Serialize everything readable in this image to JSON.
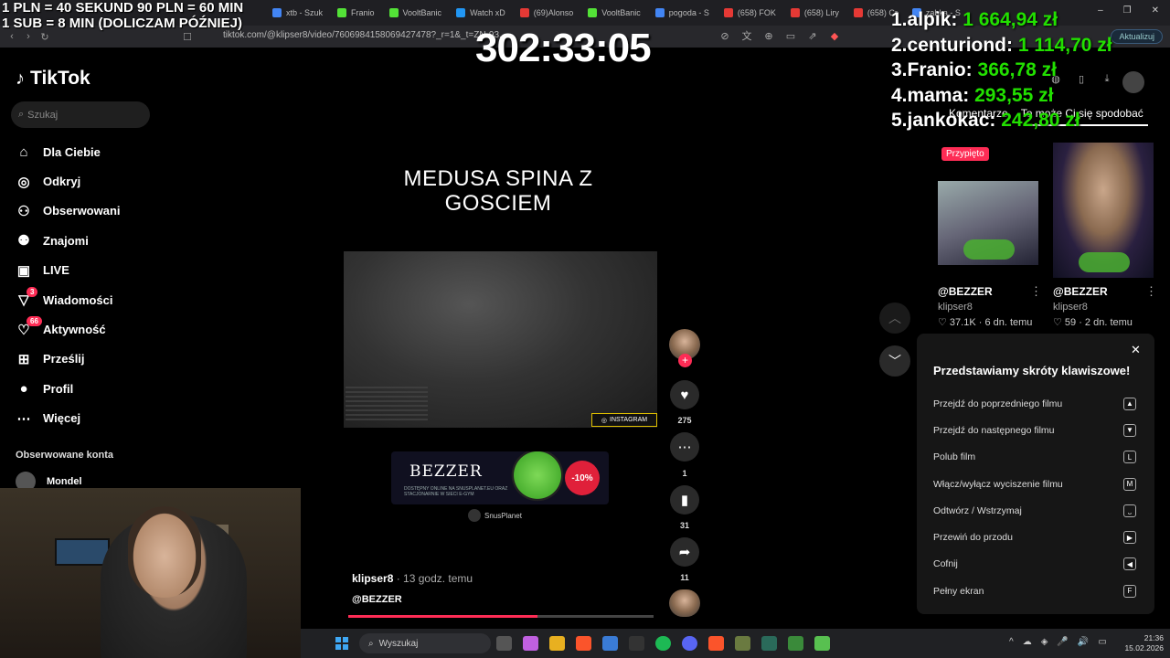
{
  "browser": {
    "tabs": [
      {
        "label": "xtb - Szuk",
        "color": "#4285f4"
      },
      {
        "label": "Franio",
        "color": "#53e237"
      },
      {
        "label": "VooltBanic",
        "color": "#53e237"
      },
      {
        "label": "Watch xD",
        "color": "#2196f3"
      },
      {
        "label": "(69)Alonso",
        "color": "#e53935"
      },
      {
        "label": "VooltBanic",
        "color": "#53e237"
      },
      {
        "label": "pogoda - S",
        "color": "#4285f4"
      },
      {
        "label": "(658) FOK",
        "color": "#e53935"
      },
      {
        "label": "(658) Liry",
        "color": "#e53935"
      },
      {
        "label": "(658) Cr",
        "color": "#e53935"
      },
      {
        "label": "zabka - S",
        "color": "#4285f4"
      }
    ],
    "url": "tiktok.com/@klipser8/video/7606984158069427478?_r=1&_t=ZN-93...",
    "update_label": "Aktualizuj"
  },
  "overlay": {
    "donate_line1": "1 PLN =  40 SEKUND 90 PLN = 60 MIN",
    "donate_line2": "1 SUB = 8 MIN (DOLICZAM PÓŹNIEJ)",
    "timer": "302:33:05",
    "leaderboard": [
      {
        "name": "1.alpik:",
        "amount": "1 664,94 zł"
      },
      {
        "name": "2.centuriond:",
        "amount": "1 114,70 zł"
      },
      {
        "name": "3.Franio:",
        "amount": "366,78 zł"
      },
      {
        "name": "4.mama:",
        "amount": "293,55 zł"
      },
      {
        "name": "5.jankokac:",
        "amount": "242,80 zł"
      }
    ]
  },
  "sidebar": {
    "logo": "TikTok",
    "search_placeholder": "Szukaj",
    "items": [
      {
        "label": "Dla Ciebie",
        "icon": "home-icon",
        "glyph": "⌂"
      },
      {
        "label": "Odkryj",
        "icon": "compass-icon",
        "glyph": "◎"
      },
      {
        "label": "Obserwowani",
        "icon": "following-icon",
        "glyph": "⚇"
      },
      {
        "label": "Znajomi",
        "icon": "friends-icon",
        "glyph": "⚉"
      },
      {
        "label": "LIVE",
        "icon": "live-icon",
        "glyph": "▣"
      },
      {
        "label": "Wiadomości",
        "icon": "messages-icon",
        "glyph": "▽",
        "badge": "3"
      },
      {
        "label": "Aktywność",
        "icon": "activity-icon",
        "glyph": "♡",
        "badge": "66"
      },
      {
        "label": "Prześlij",
        "icon": "upload-icon",
        "glyph": "⊞"
      },
      {
        "label": "Profil",
        "icon": "profile-icon",
        "glyph": "●"
      },
      {
        "label": "Więcej",
        "icon": "more-icon",
        "glyph": "⋯"
      }
    ],
    "followed_heading": "Obserwowane konta",
    "followed_account": "Mondel"
  },
  "video": {
    "caption_title": "MEDUSA SPINA Z GOSCIEM",
    "instagram_tag": "INSTAGRAM",
    "banner_brand": "BEZZER",
    "banner_promo": "-10%",
    "banner_sub": "DOSTĘPNY ONLINE NA SNUSPLANET.EU ORAZ STACJONARNIE W SIECI E-GYM",
    "snus_brand": "SnusPlanet",
    "author": "klipser8",
    "time_ago": "· 13 godz. temu",
    "description": "@BEZZER",
    "progress": 0.62,
    "likes": "275",
    "comments": "1",
    "saves": "31",
    "shares": "11"
  },
  "right_panel": {
    "tab_comments": "Komentarze",
    "tab_recommended": "To może Ci się spodobać",
    "pinned_label": "Przypięto",
    "videos": [
      {
        "handle": "@BEZZER",
        "account": "klipser8",
        "stats": "♡ 37.1K · 6 dn. temu"
      },
      {
        "handle": "@BEZZER",
        "account": "klipser8",
        "stats": "♡ 59 · 2 dn. temu"
      }
    ]
  },
  "shortcuts": {
    "title": "Przedstawiamy skróty klawiszowe!",
    "rows": [
      {
        "label": "Przejdź do poprzedniego filmu",
        "key": "▲"
      },
      {
        "label": "Przejdź do następnego filmu",
        "key": "▼"
      },
      {
        "label": "Polub film",
        "key": "L"
      },
      {
        "label": "Włącz/wyłącz wyciszenie filmu",
        "key": "M"
      },
      {
        "label": "Odtwórz / Wstrzymaj",
        "key": "⎵"
      },
      {
        "label": "Przewiń do przodu",
        "key": "▶"
      },
      {
        "label": "Cofnij",
        "key": "◀"
      },
      {
        "label": "Pełny ekran",
        "key": "F"
      }
    ]
  },
  "taskbar": {
    "search_placeholder": "Wyszukaj",
    "time": "21:36",
    "date": "15.02.2026"
  }
}
